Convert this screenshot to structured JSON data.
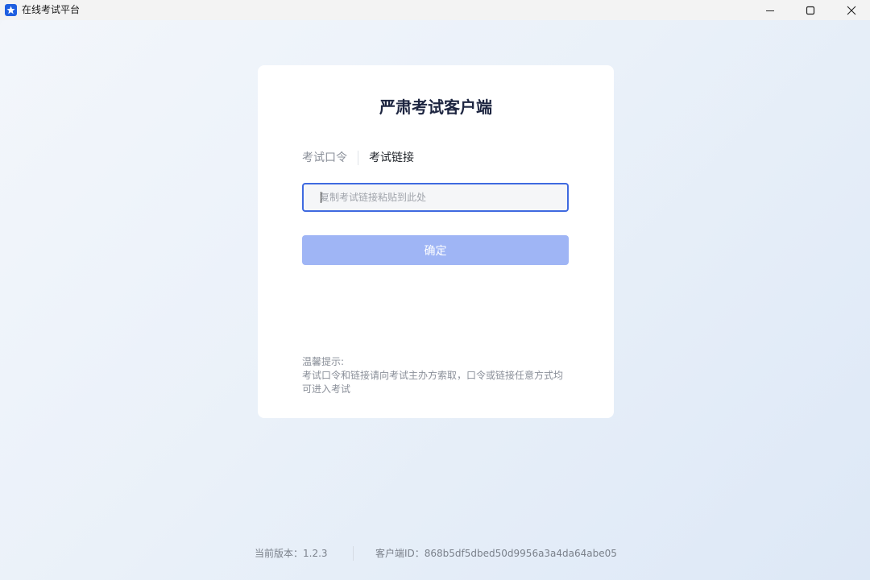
{
  "window": {
    "title": "在线考试平台",
    "icon": "star-app-icon",
    "controls": [
      "minimize-icon",
      "maximize-icon",
      "close-icon"
    ]
  },
  "card": {
    "title": "严肃考试客户端",
    "tabs": [
      {
        "label": "考试口令",
        "active": false
      },
      {
        "label": "考试链接",
        "active": true
      }
    ],
    "input": {
      "placeholder": "复制考试链接粘贴到此处",
      "value": ""
    },
    "confirm_label": "确定",
    "tips": {
      "heading": "温馨提示:",
      "body": "考试口令和链接请向考试主办方索取，口令或链接任意方式均可进入考试"
    }
  },
  "footer": {
    "version": "当前版本：1.2.3",
    "client_id": "客户端ID：868b5df5dbed50d9956a3a4da64abe05"
  },
  "colors": {
    "accent": "#3f6ae0",
    "button_disabled": "#9fb5f5",
    "title_text": "#1d2540"
  }
}
